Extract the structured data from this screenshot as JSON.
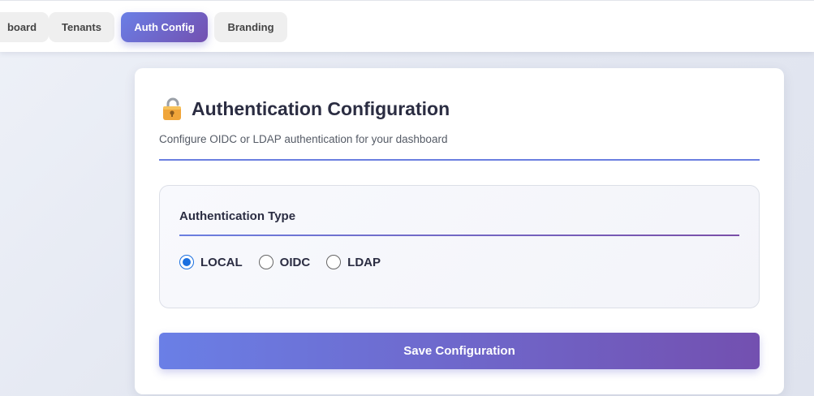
{
  "nav": {
    "tabs": [
      {
        "label": "board",
        "active": false
      },
      {
        "label": "Tenants",
        "active": false
      },
      {
        "label": "Auth Config",
        "active": true
      },
      {
        "label": "Branding",
        "active": false
      }
    ]
  },
  "main": {
    "title": "Authentication Configuration",
    "title_icon": "lock-icon",
    "subtitle": "Configure OIDC or LDAP authentication for your dashboard",
    "auth_section": {
      "heading": "Authentication Type",
      "options": [
        {
          "label": "LOCAL",
          "selected": true
        },
        {
          "label": "OIDC",
          "selected": false
        },
        {
          "label": "LDAP",
          "selected": false
        }
      ]
    },
    "save_label": "Save Configuration"
  },
  "colors": {
    "accent_start": "#6a7fe6",
    "accent_end": "#7350b0",
    "radio_selected": "#1a6fe0"
  }
}
